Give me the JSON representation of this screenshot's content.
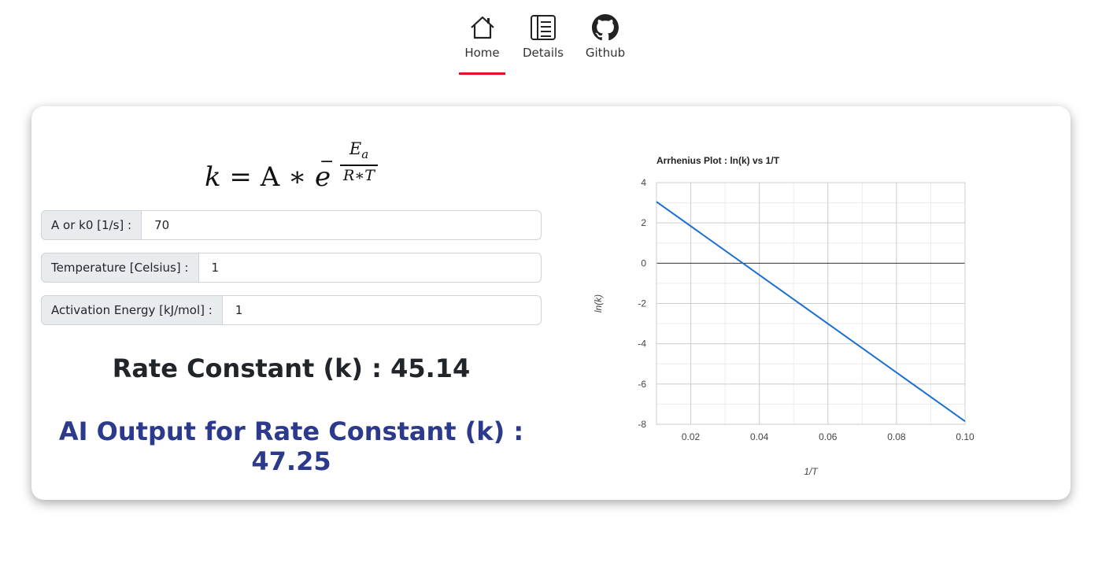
{
  "nav": {
    "items": [
      {
        "label": "Home",
        "icon": "home-icon",
        "active": true
      },
      {
        "label": "Details",
        "icon": "details-icon",
        "active": false
      },
      {
        "label": "Github",
        "icon": "github-icon",
        "active": false
      }
    ],
    "active_color": "#e0141e"
  },
  "formula": {
    "lhs": "k",
    "eq": "=",
    "a": "A",
    "times": "∗",
    "base": "e",
    "minus": "−",
    "numerator": "E",
    "numerator_sub": "a",
    "denominator": "R∗T"
  },
  "inputs": [
    {
      "label": "A or k0 [1/s] :",
      "value": "70"
    },
    {
      "label": "Temperature [Celsius] :",
      "value": "1"
    },
    {
      "label": "Activation Energy [kJ/mol] :",
      "value": "1"
    }
  ],
  "results": {
    "rate_label": "Rate Constant (k) : 45.14",
    "ai_label": "AI Output for Rate Constant (k) : 47.25",
    "ai_color": "#2b3a8c"
  },
  "chart_data": {
    "type": "line",
    "title": "Arrhenius Plot : ln(k) vs 1/T",
    "xlabel": "1/T",
    "ylabel": "ln(k)",
    "xlim": [
      0.01,
      0.1
    ],
    "ylim": [
      -8,
      4
    ],
    "xticks": [
      "0.02",
      "0.04",
      "0.06",
      "0.08",
      "0.10"
    ],
    "yticks": [
      "4",
      "2",
      "0",
      "-2",
      "-4",
      "-6",
      "-8"
    ],
    "grid": true,
    "legend": "none",
    "series": [
      {
        "x": [
          0.01,
          0.1
        ],
        "y": [
          3.05,
          -7.85
        ],
        "color": "#1a6fd1"
      }
    ]
  }
}
